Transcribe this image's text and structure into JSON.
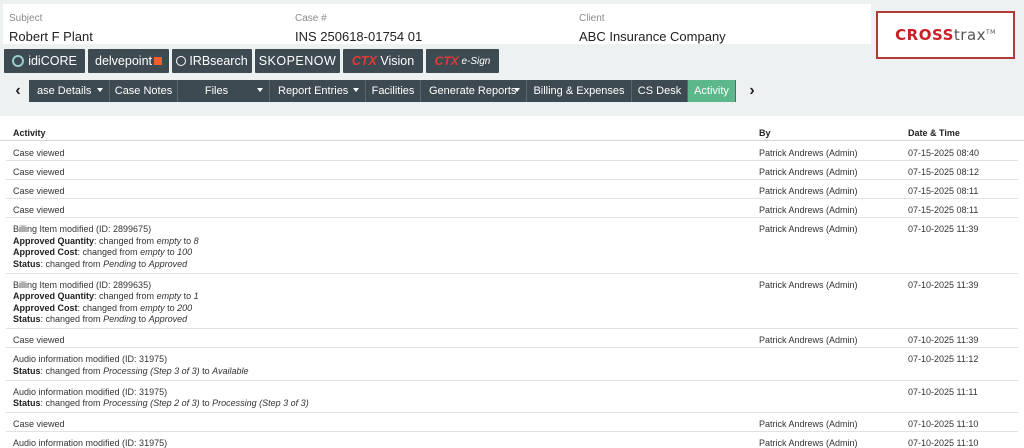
{
  "header": {
    "subject_label": "Subject",
    "subject_value": "Robert F Plant",
    "case_label": "Case #",
    "case_value": "INS 250618-01754 01",
    "client_label": "Client",
    "client_value": "ABC Insurance Company",
    "logo": {
      "part1": "CROSS",
      "part2": "trax",
      "tm": "TM"
    }
  },
  "tools": [
    {
      "name": "idicore",
      "label": "idiCORE"
    },
    {
      "name": "delvepoint",
      "label": "delvepoint"
    },
    {
      "name": "irbsearch",
      "label": "IRBsearch"
    },
    {
      "name": "skopenow",
      "label": "SKOPENOW"
    },
    {
      "name": "ctx-vision",
      "prefix": "CTX",
      "label": "Vision"
    },
    {
      "name": "ctx-esign",
      "prefix": "CTX",
      "label": "e-Sign"
    }
  ],
  "tabs": [
    {
      "label": "ase Details",
      "dropdown": true
    },
    {
      "label": "Case Notes",
      "dropdown": false
    },
    {
      "label": "Files",
      "dropdown": true
    },
    {
      "label": "Report Entries",
      "dropdown": true
    },
    {
      "label": "Facilities",
      "dropdown": false
    },
    {
      "label": "Generate Reports",
      "dropdown": true
    },
    {
      "label": "Billing & Expenses",
      "dropdown": false
    },
    {
      "label": "CS Desk",
      "dropdown": false
    },
    {
      "label": "Activity",
      "dropdown": false,
      "active": true
    }
  ],
  "table": {
    "columns": {
      "activity": "Activity",
      "by": "By",
      "datetime": "Date & Time"
    },
    "rows": [
      {
        "activity": "Case viewed",
        "by": "Patrick Andrews (Admin)",
        "datetime": "07-15-2025 08:40"
      },
      {
        "activity": "Case viewed",
        "by": "Patrick Andrews (Admin)",
        "datetime": "07-15-2025 08:12"
      },
      {
        "activity": "Case viewed",
        "by": "Patrick Andrews (Admin)",
        "datetime": "07-15-2025 08:11"
      },
      {
        "activity": "Case viewed",
        "by": "Patrick Andrews (Admin)",
        "datetime": "07-15-2025 08:11"
      },
      {
        "activity": "Billing Item modified (ID: 2899675)",
        "by": "Patrick Andrews (Admin)",
        "datetime": "07-10-2025 11:39",
        "details": [
          {
            "field": "Approved Quantity",
            "mid": ": changed from ",
            "from": "empty",
            "to_word": " to ",
            "to": "8"
          },
          {
            "field": "Approved Cost",
            "mid": ": changed from ",
            "from": "empty",
            "to_word": " to ",
            "to": "100"
          },
          {
            "field": "Status",
            "mid": ": changed from ",
            "from": "Pending",
            "to_word": " to ",
            "to": "Approved"
          }
        ]
      },
      {
        "activity": "Billing Item modified (ID: 2899635)",
        "by": "Patrick Andrews (Admin)",
        "datetime": "07-10-2025 11:39",
        "details": [
          {
            "field": "Approved Quantity",
            "mid": ": changed from ",
            "from": "empty",
            "to_word": " to ",
            "to": "1"
          },
          {
            "field": "Approved Cost",
            "mid": ": changed from ",
            "from": "empty",
            "to_word": " to ",
            "to": "200"
          },
          {
            "field": "Status",
            "mid": ": changed from ",
            "from": "Pending",
            "to_word": " to ",
            "to": "Approved"
          }
        ]
      },
      {
        "activity": "Case viewed",
        "by": "Patrick Andrews (Admin)",
        "datetime": "07-10-2025 11:39"
      },
      {
        "activity": "Audio information modified (ID: 31975)",
        "by": "",
        "datetime": "07-10-2025 11:12",
        "details": [
          {
            "field": "Status",
            "mid": ": changed from ",
            "from": "Processing (Step 3 of 3)",
            "to_word": " to ",
            "to": "Available"
          }
        ]
      },
      {
        "activity": "Audio information modified (ID: 31975)",
        "by": "",
        "datetime": "07-10-2025 11:11",
        "details": [
          {
            "field": "Status",
            "mid": ": changed from ",
            "from": "Processing (Step 2 of 3)",
            "to_word": " to ",
            "to": "Processing (Step 3 of 3)"
          }
        ]
      },
      {
        "activity": "Case viewed",
        "by": "Patrick Andrews (Admin)",
        "datetime": "07-10-2025 11:10"
      },
      {
        "activity": "Audio information modified (ID: 31975)",
        "by": "Patrick Andrews (Admin)",
        "datetime": "07-10-2025 11:10"
      }
    ]
  }
}
